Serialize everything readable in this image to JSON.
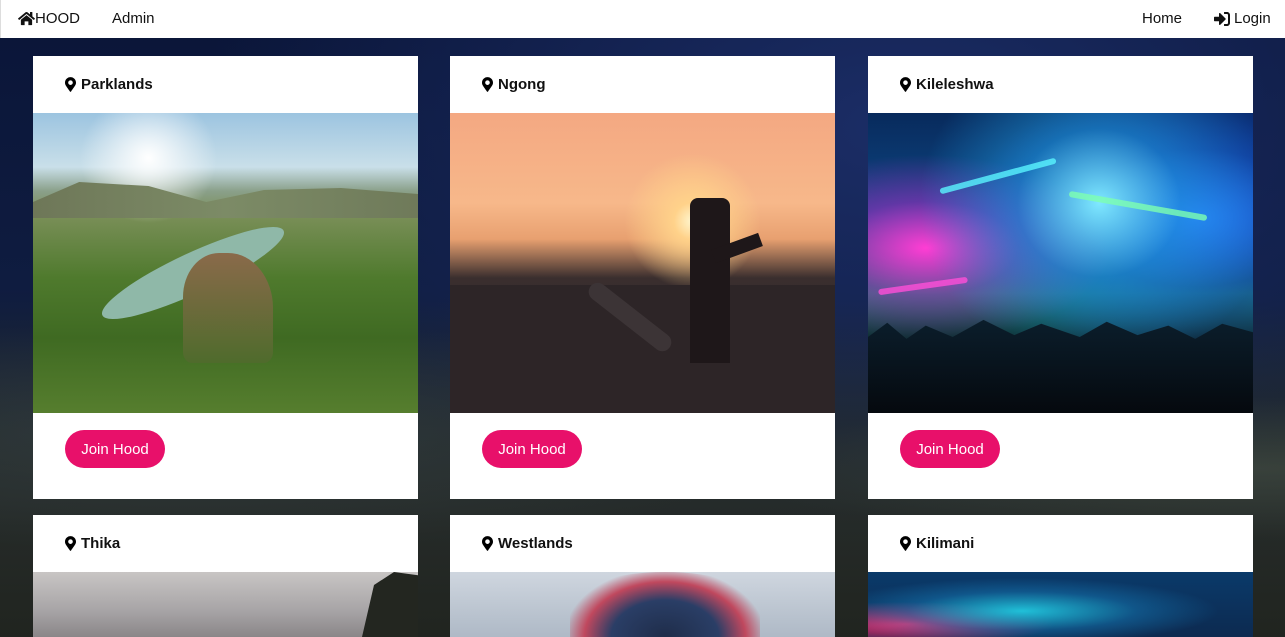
{
  "navbar": {
    "brand": "HOOD",
    "admin": "Admin",
    "home": "Home",
    "login": "Login"
  },
  "icons": {
    "brand": "home-icon",
    "login": "sign-in-icon",
    "card_title": "map-marker-icon"
  },
  "colors": {
    "join_button": "#e8106a",
    "navbar_bg": "#ffffff"
  },
  "hoods": [
    {
      "name": "Parklands",
      "button": "Join Hood"
    },
    {
      "name": "Ngong",
      "button": "Join Hood"
    },
    {
      "name": "Kileleshwa",
      "button": "Join Hood"
    },
    {
      "name": "Thika"
    },
    {
      "name": "Westlands"
    },
    {
      "name": "Kilimani"
    }
  ]
}
